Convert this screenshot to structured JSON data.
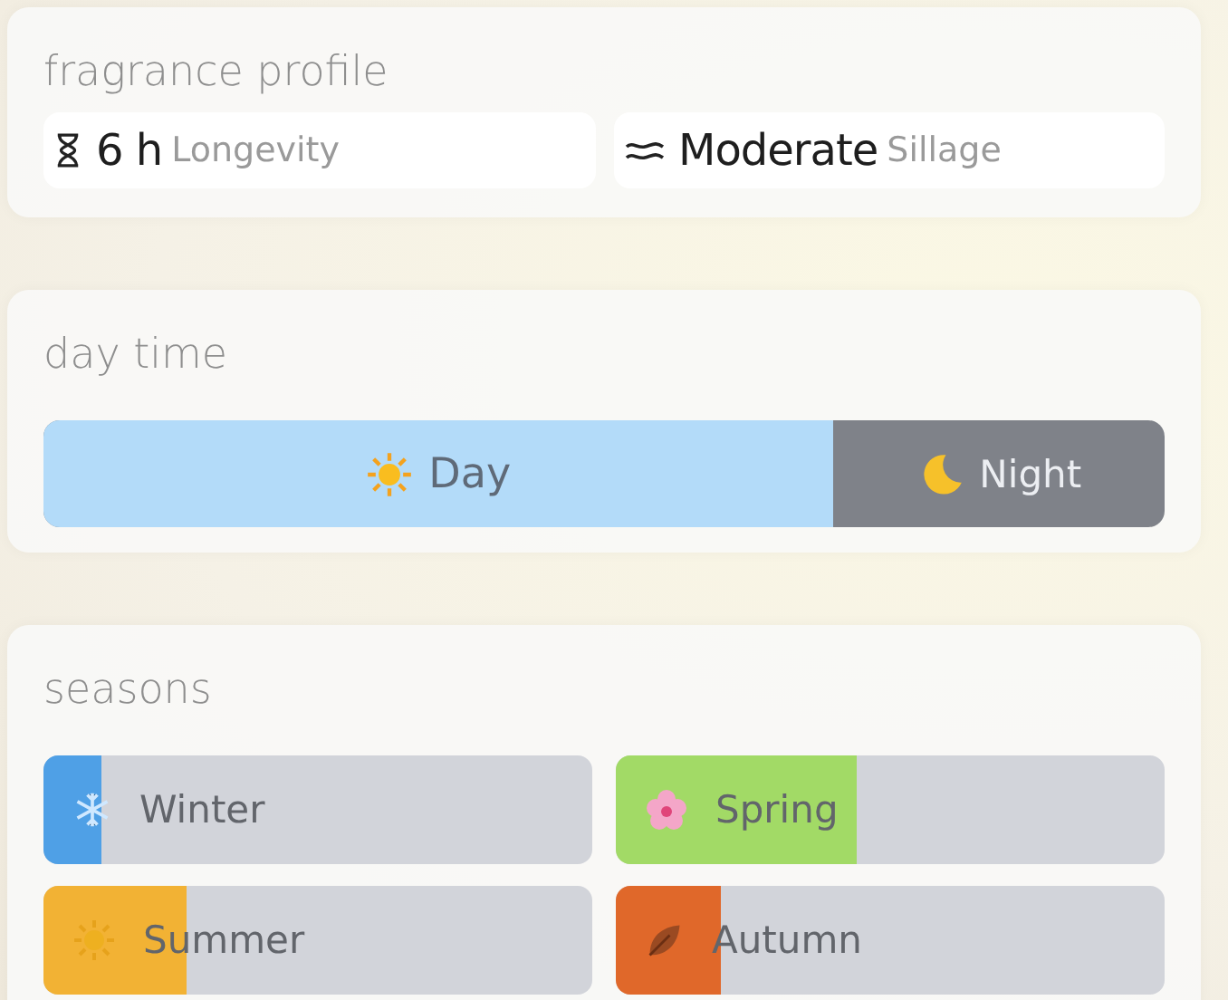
{
  "profile": {
    "title": "fragrance profile",
    "stats": [
      {
        "kind": "longevity",
        "value": "6 h",
        "label": "Longevity"
      },
      {
        "kind": "sillage",
        "value": "Moderate",
        "label": "Sillage"
      }
    ]
  },
  "daytime": {
    "title": "day time",
    "level": 0.704,
    "parts": [
      {
        "kind": "day",
        "label": "Day"
      },
      {
        "kind": "night",
        "label": "Night"
      }
    ]
  },
  "seasons": {
    "title": "seasons",
    "items": [
      {
        "kind": "winter",
        "label": "Winter",
        "level": 0.106,
        "color": "#4fa0e6"
      },
      {
        "kind": "spring",
        "label": "Spring",
        "level": 0.44,
        "color": "#a2da66"
      },
      {
        "kind": "summer",
        "label": "Summer",
        "level": 0.26,
        "color": "#f2b234"
      },
      {
        "kind": "autumn",
        "label": "Autumn",
        "level": 0.19,
        "color": "#e0682a"
      }
    ]
  }
}
